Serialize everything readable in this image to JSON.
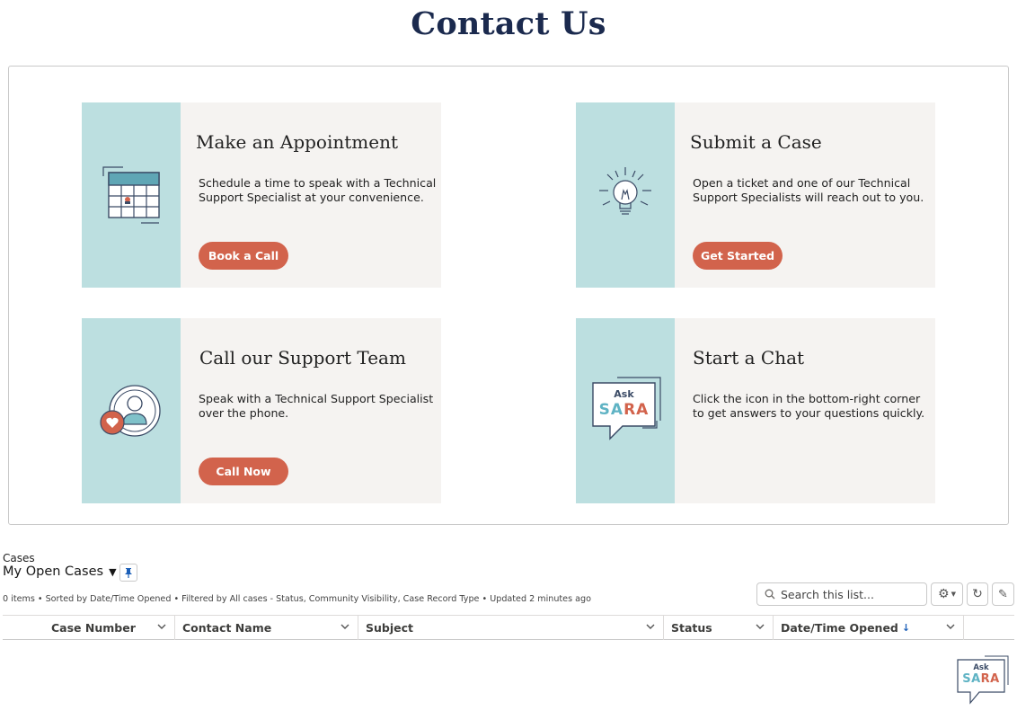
{
  "page": {
    "title": "Contact Us"
  },
  "cards": [
    {
      "title": "Make an Appointment",
      "description": "Schedule a time to speak with a Technical Support Specialist at your convenience.",
      "button": "Book a Call",
      "icon": "calendar-icon"
    },
    {
      "title": "Submit a Case",
      "description": "Open a ticket and one of our Technical Support Specialists will reach out to you.",
      "button": "Get Started",
      "icon": "lightbulb-icon"
    },
    {
      "title": "Call our Support Team",
      "description": "Speak with a Technical Support Specialist over the phone.",
      "button": "Call Now",
      "icon": "support-person-icon"
    },
    {
      "title": "Start a Chat",
      "description": "Click the icon in the bottom-right corner to get answers to your questions quickly.",
      "button": "",
      "icon": "ask-sara-chat-icon"
    }
  ],
  "sara": {
    "ask": "Ask",
    "name_part1": "SA",
    "name_part2": "RA"
  },
  "cases": {
    "object_label": "Cases",
    "list_view": "My Open Cases",
    "meta": "0 items • Sorted by Date/Time Opened • Filtered by All cases - Status, Community Visibility, Case Record Type • Updated 2 minutes ago",
    "search_placeholder": "Search this list...",
    "columns": [
      "Case Number",
      "Contact Name",
      "Subject",
      "Status",
      "Date/Time Opened"
    ],
    "sorted_column": "Date/Time Opened",
    "rows": []
  },
  "colors": {
    "accent": "#d2634c",
    "strip": "#bcdfe0",
    "card_bg": "#f5f3f1",
    "title": "#1b2a4e",
    "sara_blue": "#5fb3c4",
    "sara_orange": "#d2634c"
  }
}
